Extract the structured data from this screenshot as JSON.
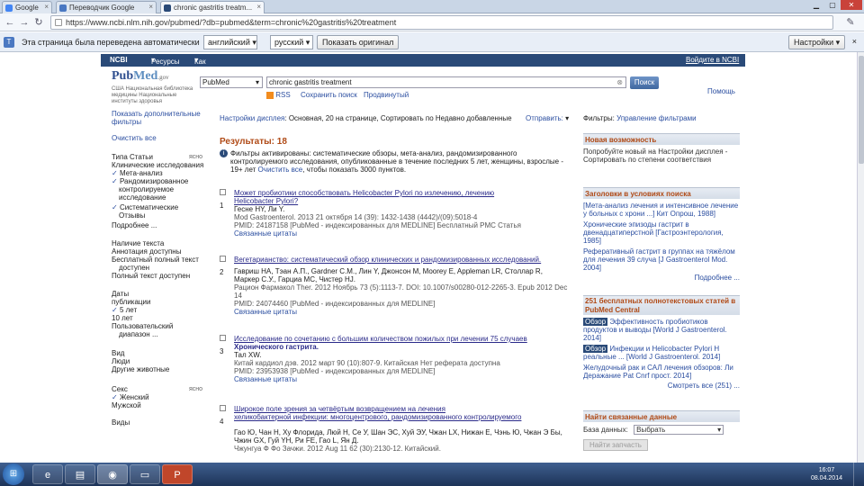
{
  "browser": {
    "tabs": [
      {
        "label": "Google"
      },
      {
        "label": "Переводчик Google"
      },
      {
        "label": "chronic gastritis treatm..."
      }
    ],
    "url": "https://www.ncbi.nlm.nih.gov/pubmed/?db=pubmed&term=chronic%20gastritis%20treatment",
    "translate_bar": {
      "text": "Эта страница была переведена автоматически",
      "from_lang": "английский",
      "to_lang": "русский",
      "show_original": "Показать оригинал",
      "settings": "Настройки"
    }
  },
  "ncbi": {
    "brand": "NCBI",
    "resources": "Ресурсы",
    "how_to": "Как",
    "login": "Войдите в NCBI"
  },
  "search": {
    "logo_pub": "Pub",
    "logo_med": "Med",
    "logo_gov": ".gov",
    "logo_sub": "США Национальная библиотека медицины Национальные институты здоровья",
    "db": "PubMed",
    "query": "chronic gastritis treatment",
    "button": "Поиск",
    "rss": "RSS",
    "save_search": "Сохранить поиск",
    "advanced": "Продвинутый",
    "help": "Помощь"
  },
  "left": {
    "show_more": "Показать дополнительные",
    "filters": "фильтры",
    "clear_all": "Очистить все",
    "article_types_label": "Типа Статьи",
    "clear": "ясно",
    "items": [
      {
        "text": "Клинические исследования",
        "checked": false
      },
      {
        "text": "Мета-анализ",
        "checked": true
      },
      {
        "text": "Рандомизированное",
        "checked": true
      },
      {
        "text": "контролируемое",
        "checked": false
      },
      {
        "text": "исследование",
        "checked": false
      },
      {
        "text": "Систематические",
        "checked": true
      },
      {
        "text": "Отзывы",
        "checked": false
      },
      {
        "text": "Подробнее ...",
        "checked": false
      }
    ],
    "text_avail": [
      "Наличие текста",
      "Аннотация доступны",
      "Бесплатный полный текст",
      "доступен",
      "Полный текст доступен"
    ],
    "pub_dates_label": "Даты",
    "pub_dates_label2": "публикации",
    "pub_dates": [
      {
        "text": "5 лет",
        "checked": true
      },
      {
        "text": "10 лет",
        "checked": false
      },
      {
        "text": "Пользовательский",
        "checked": false
      },
      {
        "text": "диапазон ...",
        "checked": false
      }
    ],
    "species_label": "Вид",
    "species": [
      "Люди",
      "Другие животные"
    ],
    "sex_label": "Секс",
    "sex": [
      {
        "text": "Женский",
        "checked": true
      },
      {
        "text": "Мужской",
        "checked": false
      }
    ],
    "last_label": "Виды"
  },
  "main": {
    "display_settings": "Настройки дисплея",
    "display_value": ": Основная, 20 на странице, Сортировать по Недавно добавленные",
    "send_to": "Отправить:",
    "results_label": "Результаты: 18",
    "filter_msg": "Фильтры активированы: систематические обзоры, мета-анализ, рандомизированного контролируемого исследования, опубликованные в течение последних 5 лет, женщины, взрослые - 19+ лет",
    "filter_clear": "Очистить все",
    "filter_tail": ", чтобы показать 3000 пунктов.",
    "results": [
      {
        "num": "1",
        "title": "Может пробиотики способствовать Helicobacter Pylori по излечению, лечению",
        "title2": "Helicobacter Pylori?",
        "authors": "Гесне HY, Ли Y.",
        "journal": "Mod Gastroenterol. 2013 21 октября 14 (39): 1432-1438 (4442)/(09):5018-4",
        "pmid": "PMID: 24187158 [PubMed - индексированных для MEDLINE]  Бесплатный PMC Статья",
        "related": "Связанные цитаты"
      },
      {
        "num": "2",
        "title": "Вегетарианство: систематический обзор клинических и рандомизированных исследований.",
        "title2": "",
        "authors": "Гавриш НА, Тэан А.П., Gardner C.M., Лин Y, Джонсон М, Moorey E, Appleman LR, Столлар R,",
        "journal": "Маркер С.У., Гарциа МС, Чистер HJ.",
        "pmid": "PMID: 24074460 [PubMed - индексированных для MEDLINE]",
        "related": "Связанные цитаты",
        "extra": "Рацион Фармакол Ther. 2012 Ноябрь 73 (5):1113-7. DOI: 10.1007/s00280-012-2265-3. Epub 2012 Dec 14"
      },
      {
        "num": "3",
        "title": "Исследование по сочетанию с большим количеством пожилых при лечении 75 случаев",
        "title2": "Хронического гастрита.",
        "authors": "Тал XW.",
        "journal": "Китай кардиол дэв. 2012 март 90 (10):807-9. Китайская Нет реферата доступна",
        "pmid": "PMID: 23953938 [PubMed - индексированных для MEDLINE]",
        "related": "Связанные цитаты"
      },
      {
        "num": "4",
        "title": "Широкое поле зрения за четвёртым возвращением на лечения",
        "title2": "хеликобактерной инфекции: многоцентрового, рандомизированного контролируемого",
        "authors": "Гао Ю, Чан Н, Ху Флорида, Люй Н, Се У, Шан ЭС, Хуй ЭУ, Чжан LX, Нижан Е, Чэнь Ю, Чжан Э Бы,",
        "journal": "Чжин GX, Гуй YH, Ри FE, Гао L, Ян Д.",
        "pmid": "Чжунгуа Ф Фо Зачжи. 2012 Aug 11 62 (30):2130-12. Китайский.",
        "related": ""
      }
    ]
  },
  "right": {
    "filters_label": "Фильтры:",
    "manage_filters": "Управление фильтрами",
    "box1": {
      "head": "Новая возможность",
      "text": "Попробуйте новый на Настройки дисплея - Сортировать по степени соответствия"
    },
    "box2": {
      "head": "Заголовки в условиях поиска",
      "items": [
        "[Мета-анализ лечения и интенсивное лечение у больных с хрони ...] Кит Опрош, 1988]",
        "Хронические эпизоды гастрит в двенадцатиперстной [Гастроэнтерология, 1985]",
        "Реферативный гастрит в группах на тяжёлом для лечения 39 случа [J Gastroenterol Mod. 2004]"
      ],
      "more": "Подробнее ..."
    },
    "box3": {
      "head": "251 бесплатных полнотекстовых статей в PubMed Central",
      "items": [
        {
          "badge": "Обзор",
          "text": "Эффективность пробиотиков продуктов и выводы [World J Gastroenterol. 2014]"
        },
        {
          "badge": "Обзор",
          "text": "Инфекции и Helicobacter Pylori Н реальные ... [World J Gastroenterol. 2014]"
        },
        {
          "badge": "",
          "text": "Желудочный рак и САЛ лечения обзоров: Ли Деражание Pat Cnrf прост. 2014]"
        }
      ],
      "more": "Смотреть все (251) ..."
    },
    "box4": {
      "head": "Найти связанные данные",
      "db_label": "База данных:",
      "db_value": "Выбрать",
      "find": "Найти запчасть"
    }
  },
  "taskbar": {
    "time": "16:07",
    "date": "08.04.2014"
  },
  "colors": {
    "ncbi_bar": "#2a4a78",
    "accent_orange": "#b04a16",
    "link": "#2b4ea0"
  }
}
